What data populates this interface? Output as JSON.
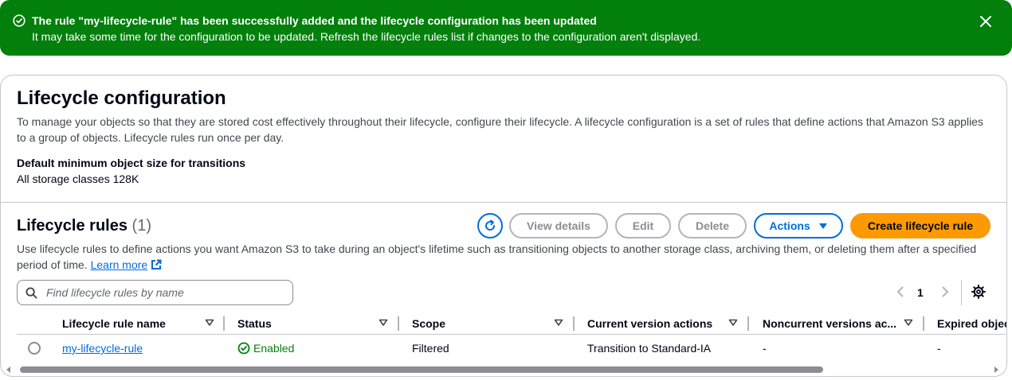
{
  "flash": {
    "title": "The rule \"my-lifecycle-rule\" has been successfully added and the lifecycle configuration has been updated",
    "body": "It may take some time for the configuration to be updated. Refresh the lifecycle rules list if changes to the configuration aren't displayed.",
    "status_icon": "success-circle-icon",
    "close_icon": "close-icon",
    "color": "#037f0c"
  },
  "config": {
    "title": "Lifecycle configuration",
    "description": "To manage your objects so that they are stored cost effectively throughout their lifecycle, configure their lifecycle. A lifecycle configuration is a set of rules that define actions that Amazon S3 applies to a group of objects. Lifecycle rules run once per day.",
    "min_size_label": "Default minimum object size for transitions",
    "min_size_value": "All storage classes 128K"
  },
  "rules": {
    "title": "Lifecycle rules",
    "count": "(1)",
    "description": "Use lifecycle rules to define actions you want Amazon S3 to take during an object's lifetime such as transitioning objects to another storage class, archiving them, or deleting them after a specified period of time.",
    "learn_more": "Learn more",
    "buttons": {
      "view_details": "View details",
      "edit": "Edit",
      "delete": "Delete",
      "actions": "Actions",
      "create": "Create lifecycle rule"
    },
    "search_placeholder": "Find lifecycle rules by name",
    "page": "1",
    "columns": [
      "Lifecycle rule name",
      "Status",
      "Scope",
      "Current version actions",
      "Noncurrent versions ac...",
      "Expired objec"
    ],
    "rows": [
      {
        "name": "my-lifecycle-rule",
        "status": "Enabled",
        "scope": "Filtered",
        "current_actions": "Transition to Standard-IA",
        "noncurrent_actions": "-",
        "expired": "-"
      }
    ]
  },
  "colors": {
    "primary_button": "#ff9900",
    "link": "#006ce0",
    "success": "#037f0c"
  }
}
